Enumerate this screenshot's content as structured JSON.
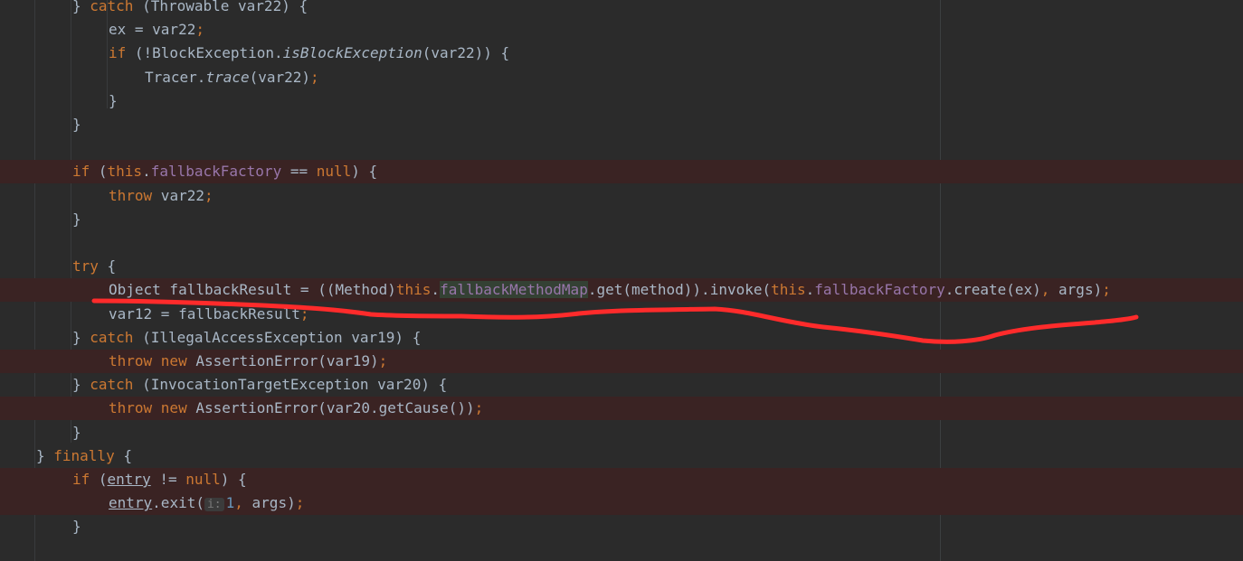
{
  "editor": {
    "theme": {
      "background": "#2b2b2b",
      "breakpoint_line": "#3a2323",
      "keyword": "#cc7832",
      "text": "#a9b7c6",
      "field": "#9876aa",
      "number": "#6897bb",
      "annotation": "#ff2b2b"
    },
    "lines": [
      {
        "indent": 2,
        "bp": false,
        "tokens": [
          {
            "t": "} ",
            "c": "txt"
          },
          {
            "t": "catch",
            "c": "kw"
          },
          {
            "t": " (Throwable var22) {",
            "c": "txt"
          }
        ]
      },
      {
        "indent": 3,
        "bp": false,
        "tokens": [
          {
            "t": "ex = var22",
            "c": "txt"
          },
          {
            "t": ";",
            "c": "kw"
          }
        ]
      },
      {
        "indent": 3,
        "bp": false,
        "tokens": [
          {
            "t": "if",
            "c": "kw"
          },
          {
            "t": " (!BlockException.",
            "c": "txt"
          },
          {
            "t": "isBlockException",
            "c": "it"
          },
          {
            "t": "(var22)) {",
            "c": "txt"
          }
        ]
      },
      {
        "indent": 4,
        "bp": false,
        "tokens": [
          {
            "t": "Tracer.",
            "c": "txt"
          },
          {
            "t": "trace",
            "c": "it"
          },
          {
            "t": "(var22)",
            "c": "txt"
          },
          {
            "t": ";",
            "c": "kw"
          }
        ]
      },
      {
        "indent": 3,
        "bp": false,
        "tokens": [
          {
            "t": "}",
            "c": "txt"
          }
        ]
      },
      {
        "indent": 2,
        "bp": false,
        "tokens": [
          {
            "t": "}",
            "c": "txt"
          }
        ]
      },
      {
        "indent": 0,
        "bp": false,
        "tokens": []
      },
      {
        "indent": 2,
        "bp": true,
        "tokens": [
          {
            "t": "if",
            "c": "kw"
          },
          {
            "t": " (",
            "c": "txt"
          },
          {
            "t": "this",
            "c": "kw"
          },
          {
            "t": ".",
            "c": "txt"
          },
          {
            "t": "fallbackFactory",
            "c": "fld"
          },
          {
            "t": " == ",
            "c": "txt"
          },
          {
            "t": "null",
            "c": "kw"
          },
          {
            "t": ") {",
            "c": "txt"
          }
        ]
      },
      {
        "indent": 3,
        "bp": false,
        "tokens": [
          {
            "t": "throw",
            "c": "kw"
          },
          {
            "t": " var22",
            "c": "txt"
          },
          {
            "t": ";",
            "c": "kw"
          }
        ]
      },
      {
        "indent": 2,
        "bp": false,
        "tokens": [
          {
            "t": "}",
            "c": "txt"
          }
        ]
      },
      {
        "indent": 0,
        "bp": false,
        "tokens": []
      },
      {
        "indent": 2,
        "bp": false,
        "tokens": [
          {
            "t": "try",
            "c": "kw"
          },
          {
            "t": " {",
            "c": "txt"
          }
        ]
      },
      {
        "indent": 3,
        "bp": true,
        "tokens": [
          {
            "t": "Object fallbackResult = ((Method)",
            "c": "txt"
          },
          {
            "t": "this",
            "c": "kw"
          },
          {
            "t": ".",
            "c": "txt"
          },
          {
            "t": "fallbackMethodMap",
            "c": "fld hl"
          },
          {
            "t": ".get(method)).invoke(",
            "c": "txt"
          },
          {
            "t": "this",
            "c": "kw"
          },
          {
            "t": ".",
            "c": "txt"
          },
          {
            "t": "fallbackFactory",
            "c": "fld"
          },
          {
            "t": ".create(ex)",
            "c": "txt"
          },
          {
            "t": ",",
            "c": "kw"
          },
          {
            "t": " args)",
            "c": "txt"
          },
          {
            "t": ";",
            "c": "kw"
          }
        ]
      },
      {
        "indent": 3,
        "bp": false,
        "tokens": [
          {
            "t": "var12 = fallbackResult",
            "c": "txt"
          },
          {
            "t": ";",
            "c": "kw"
          }
        ]
      },
      {
        "indent": 2,
        "bp": false,
        "tokens": [
          {
            "t": "} ",
            "c": "txt"
          },
          {
            "t": "catch",
            "c": "kw"
          },
          {
            "t": " (IllegalAccessException var19) {",
            "c": "txt"
          }
        ]
      },
      {
        "indent": 3,
        "bp": true,
        "tokens": [
          {
            "t": "throw new",
            "c": "kw"
          },
          {
            "t": " AssertionError(var19)",
            "c": "txt"
          },
          {
            "t": ";",
            "c": "kw"
          }
        ]
      },
      {
        "indent": 2,
        "bp": false,
        "tokens": [
          {
            "t": "} ",
            "c": "txt"
          },
          {
            "t": "catch",
            "c": "kw"
          },
          {
            "t": " (InvocationTargetException var20) {",
            "c": "txt"
          }
        ]
      },
      {
        "indent": 3,
        "bp": true,
        "tokens": [
          {
            "t": "throw new",
            "c": "kw"
          },
          {
            "t": " AssertionError(var20.getCause())",
            "c": "txt"
          },
          {
            "t": ";",
            "c": "kw"
          }
        ]
      },
      {
        "indent": 2,
        "bp": false,
        "tokens": [
          {
            "t": "}",
            "c": "txt"
          }
        ]
      },
      {
        "indent": 1,
        "bp": false,
        "tokens": [
          {
            "t": "} ",
            "c": "txt"
          },
          {
            "t": "finally",
            "c": "kw"
          },
          {
            "t": " {",
            "c": "txt"
          }
        ]
      },
      {
        "indent": 2,
        "bp": true,
        "tokens": [
          {
            "t": "if",
            "c": "kw"
          },
          {
            "t": " (",
            "c": "txt"
          },
          {
            "t": "entry",
            "c": "txt ul"
          },
          {
            "t": " != ",
            "c": "txt"
          },
          {
            "t": "null",
            "c": "kw"
          },
          {
            "t": ") {",
            "c": "txt"
          }
        ]
      },
      {
        "indent": 3,
        "bp": true,
        "tokens": [
          {
            "t": "entry",
            "c": "txt ul"
          },
          {
            "t": ".exit(",
            "c": "txt"
          },
          {
            "t": "i:",
            "c": "hint"
          },
          {
            "t": "1",
            "c": "num"
          },
          {
            "t": ",",
            "c": "kw"
          },
          {
            "t": " args)",
            "c": "txt"
          },
          {
            "t": ";",
            "c": "kw"
          }
        ]
      },
      {
        "indent": 2,
        "bp": false,
        "tokens": [
          {
            "t": "}",
            "c": "txt"
          }
        ]
      }
    ]
  }
}
